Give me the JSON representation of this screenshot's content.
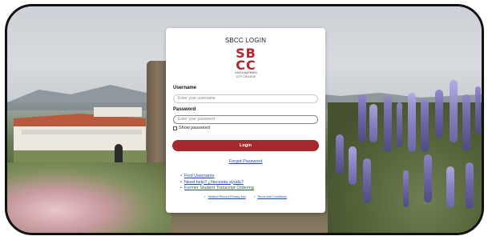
{
  "card": {
    "title": "SBCC LOGIN",
    "logo": {
      "line1": "SB",
      "line2": "CC",
      "subtext_line1": "SANTA BARBARA",
      "subtext_line2": "CITY COLLEGE"
    },
    "username": {
      "label": "Username",
      "placeholder": "Enter your username"
    },
    "password": {
      "label": "Password",
      "placeholder": "Enter your password"
    },
    "show_password_label": "Show password",
    "login_button": "Login",
    "forgot_password": "Forgot Password",
    "help_links": [
      "Find Username",
      "Need help? ¿Necesita ayuda?",
      "Former Student Transcript Ordering"
    ],
    "footer_links": [
      "Student Record Privacy Info",
      "Terms and Conditions"
    ]
  },
  "colors": {
    "brand_red": "#a5282c",
    "link_blue": "#1f4f9e"
  }
}
